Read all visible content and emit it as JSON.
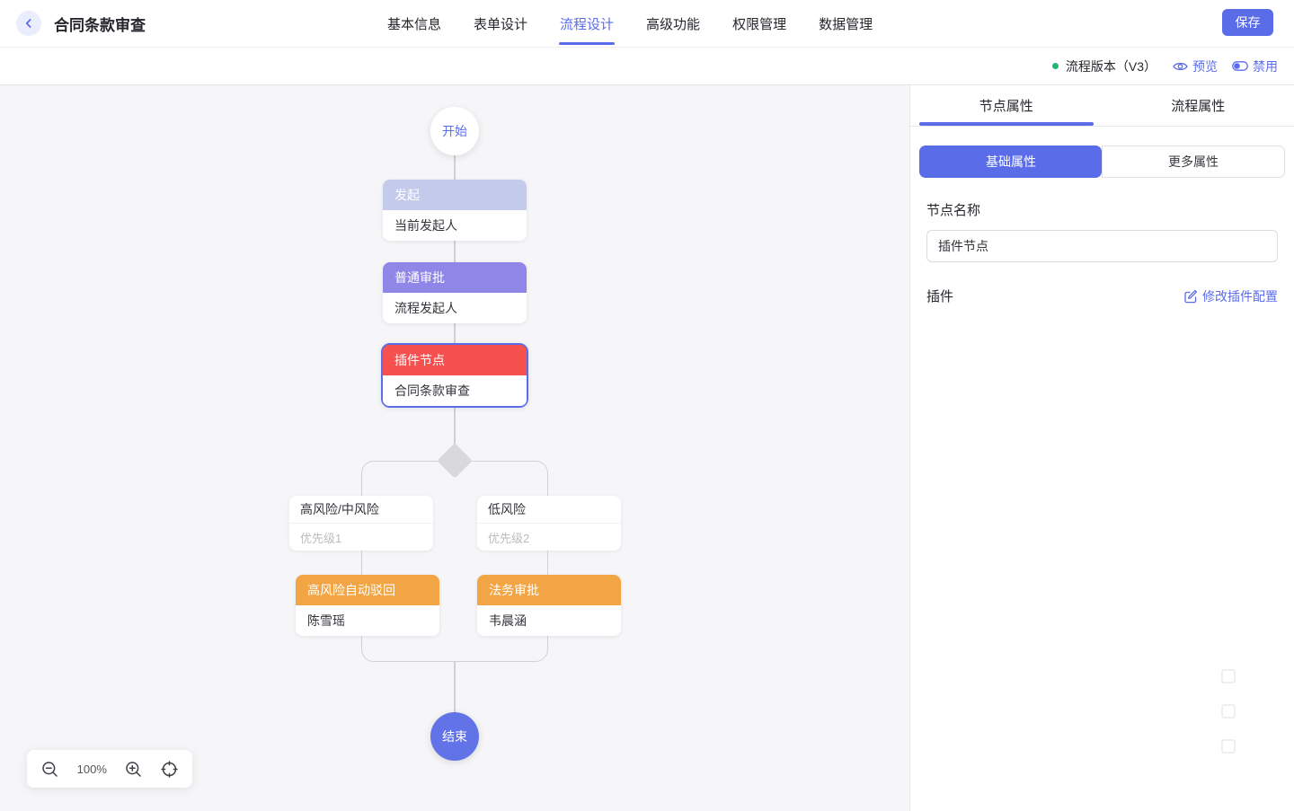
{
  "header": {
    "title": "合同条款审查",
    "nav": [
      {
        "label": "基本信息"
      },
      {
        "label": "表单设计"
      },
      {
        "label": "流程设计"
      },
      {
        "label": "高级功能"
      },
      {
        "label": "权限管理"
      },
      {
        "label": "数据管理"
      }
    ],
    "save_label": "保存"
  },
  "version_bar": {
    "version_label": "流程版本（V3）",
    "preview_label": "预览",
    "disable_label": "禁用"
  },
  "canvas": {
    "start_label": "开始",
    "end_label": "结束",
    "nodes": {
      "initiate": {
        "title": "发起",
        "body": "当前发起人"
      },
      "approval": {
        "title": "普通审批",
        "body": "流程发起人"
      },
      "plugin": {
        "title": "插件节点",
        "body": "合同条款审查"
      },
      "reject": {
        "title": "高风险自动驳回",
        "body": "陈雪瑶"
      },
      "legal": {
        "title": "法务审批",
        "body": "韦晨涵"
      }
    },
    "conditions": {
      "left": {
        "title": "高风险/中风险",
        "priority": "优先级1"
      },
      "right": {
        "title": "低风险",
        "priority": "优先级2"
      }
    },
    "zoom_level": "100%"
  },
  "panel": {
    "tabs": [
      {
        "label": "节点属性"
      },
      {
        "label": "流程属性"
      }
    ],
    "subtabs": [
      {
        "label": "基础属性"
      },
      {
        "label": "更多属性"
      }
    ],
    "node_name_label": "节点名称",
    "node_name_value": "插件节点",
    "plugin_label": "插件",
    "plugin_edit_label": "修改插件配置"
  },
  "colors": {
    "accent": "#5B6CE8",
    "initiate_header": "#C3CAEC",
    "approval_header": "#8F86E8",
    "plugin_header": "#F4514F",
    "orange_header": "#F2A544",
    "status_green": "#23B573",
    "canvas_bg": "#F6F6F8"
  }
}
